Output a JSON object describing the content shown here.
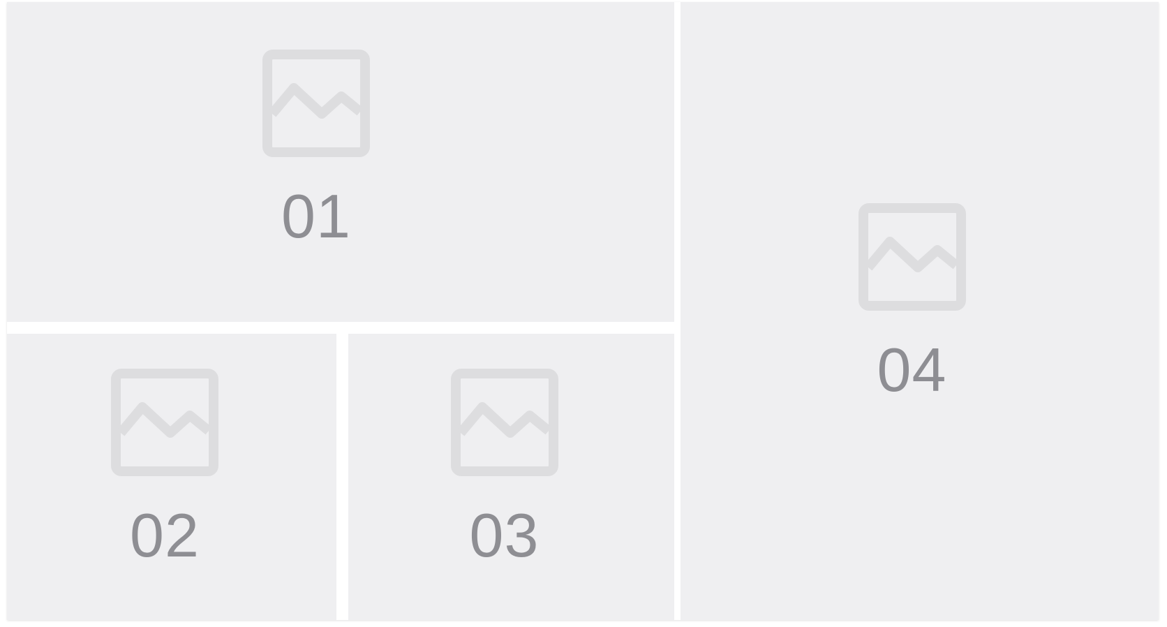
{
  "colors": {
    "tile_background": "#efeff1",
    "divider": "#ffffff",
    "icon": "#dddddf",
    "label": "#8e8e93"
  },
  "tiles": [
    {
      "label": "01",
      "icon": "image-placeholder-icon"
    },
    {
      "label": "02",
      "icon": "image-placeholder-icon"
    },
    {
      "label": "03",
      "icon": "image-placeholder-icon"
    },
    {
      "label": "04",
      "icon": "image-placeholder-icon"
    }
  ]
}
